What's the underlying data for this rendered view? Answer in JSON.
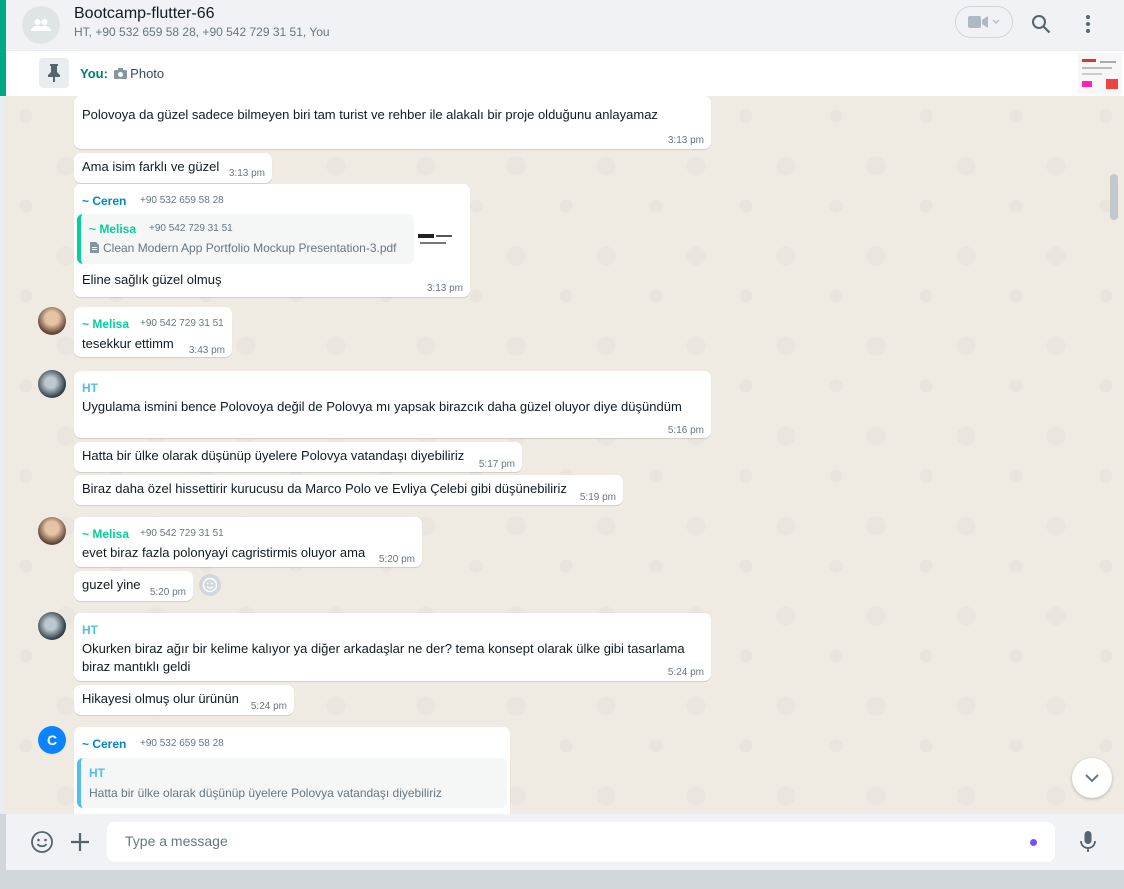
{
  "header": {
    "title": "Bootcamp-flutter-66",
    "subtitle": "HT, +90 532 659 58 28, +90 542 729 31 51, You"
  },
  "pinned": {
    "you_label": "You:",
    "text": "Photo"
  },
  "messages": {
    "m1": {
      "text": "Polovoya da güzel sadece bilmeyen biri tam turist ve rehber ile alakalı bir proje olduğunu anlayamaz",
      "time": "3:13 pm"
    },
    "m2": {
      "text": "Ama isim farklı ve güzel",
      "time": "3:13 pm"
    },
    "m3": {
      "sender": "~ Ceren",
      "phone": "+90 532 659 58 28",
      "quote_sender": "~ Melisa",
      "quote_phone": "+90 542 729 31 51",
      "quote_file": "Clean Modern App Portfolio Mockup Presentation-3.pdf",
      "text": "Eline sağlık güzel olmuş",
      "time": "3:13 pm"
    },
    "m4": {
      "sender": "~ Melisa",
      "phone": "+90 542 729 31 51",
      "text": "tesekkur ettimm",
      "time": "3:43 pm"
    },
    "m5": {
      "sender": "HT",
      "text": "Uygulama ismini bence Polovoya değil de Polovya mı yapsak birazcık daha güzel oluyor diye düşündüm",
      "time": "5:16 pm"
    },
    "m6": {
      "text": "Hatta bir ülke olarak düşünüp üyelere Polovya vatandaşı diyebiliriz",
      "time": "5:17 pm"
    },
    "m7": {
      "text": "Biraz daha özel hissettirir kurucusu da Marco Polo ve Evliya Çelebi gibi düşünebiliriz",
      "time": "5:19 pm"
    },
    "m8": {
      "sender": "~ Melisa",
      "phone": "+90 542 729 31 51",
      "text": "evet biraz fazla polonyayi cagristirmis oluyor ama",
      "time": "5:20 pm"
    },
    "m9": {
      "text": "guzel yine",
      "time": "5:20 pm"
    },
    "m10": {
      "sender": "HT",
      "text_line1": "Okurken biraz ağır bir kelime kalıyor ya diğer arkadaşlar ne der? tema konsept olarak ülke gibi tasarlama",
      "text_line2": "biraz mantıklı geldi",
      "time": "5:24 pm"
    },
    "m11": {
      "text": "Hikayesi olmuş olur ürünün",
      "time": "5:24 pm"
    },
    "m12": {
      "avatar_letter": "C",
      "sender": "~ Ceren",
      "phone": "+90 532 659 58 28",
      "quote_sender": "HT",
      "quote_text": "Hatta bir ülke olarak düşünüp üyelere Polovya vatandaşı diyebiliriz"
    }
  },
  "composer": {
    "placeholder": "Type a message"
  },
  "colors": {
    "accent": "#00a884",
    "chat_bg": "#efeae2",
    "bubble": "#ffffff",
    "sender_melisa": "#06cf9c",
    "sender_ceren": "#0086c9",
    "sender_ht": "#53bdeb"
  },
  "icons": [
    "group-icon",
    "video-call-icon",
    "search-icon",
    "menu-icon",
    "pin-icon",
    "camera-icon",
    "document-icon",
    "emoji-icon",
    "plus-icon",
    "microphone-icon",
    "chevron-down-icon",
    "smiley-reaction-icon"
  ]
}
